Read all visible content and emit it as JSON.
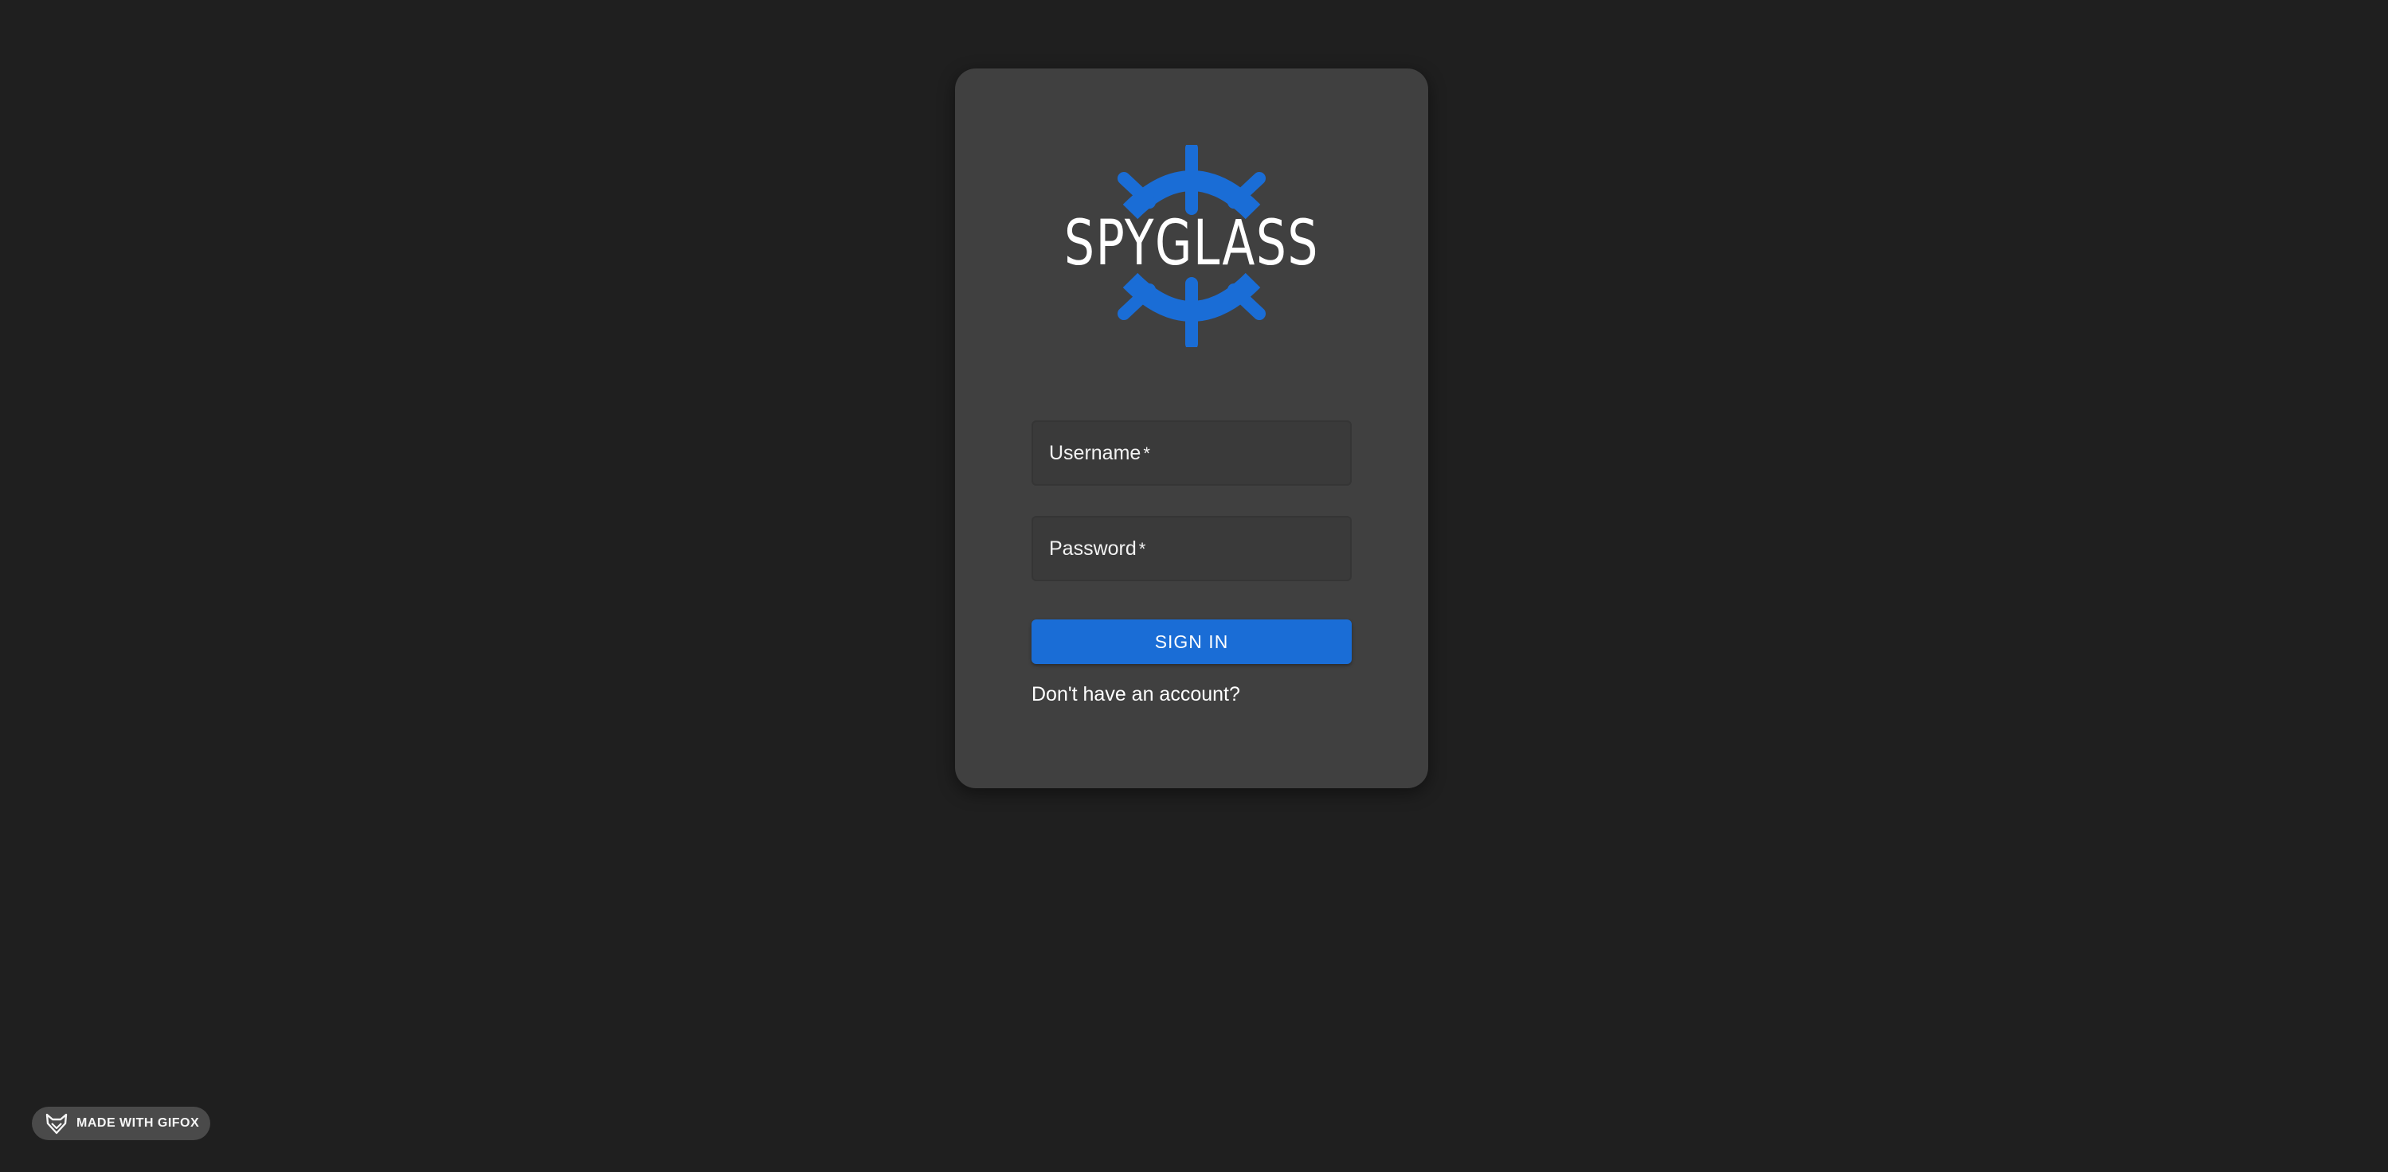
{
  "brand": {
    "logo_text": "SPYGLASS",
    "logo_color": "#1a6dd6"
  },
  "form": {
    "username_label": "Username",
    "password_label": "Password",
    "required_marker": "*",
    "signin_label": "SIGN IN",
    "signup_link": "Don't have an account?"
  },
  "badge": {
    "icon": "fox-icon",
    "text": "MADE WITH GIFOX"
  },
  "colors": {
    "background": "#1f1f1f",
    "card": "#404040",
    "accent": "#1a6dd6"
  }
}
